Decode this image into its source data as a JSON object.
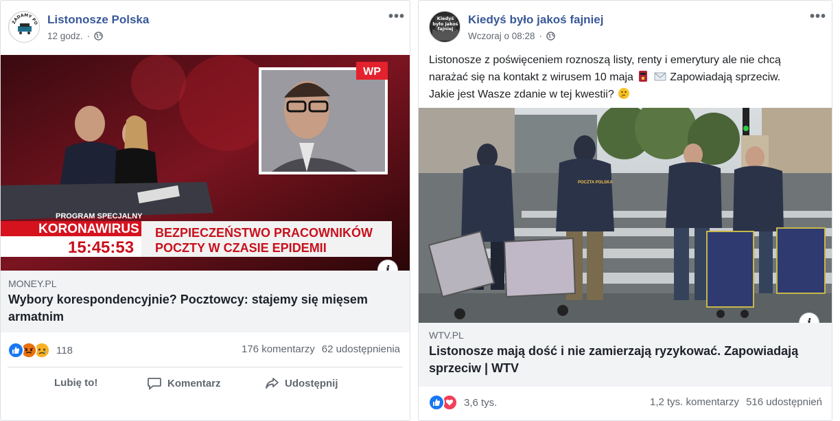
{
  "post1": {
    "page_name": "Listonosze Polska",
    "time": "12 godz.",
    "avatar_text": "ZADAMY PODWYŻEK",
    "media": {
      "tv_logo": "WP",
      "program_label": "PROGRAM SPECJALNY",
      "topic": "KORONAWIRUS",
      "clock": "15:45:53",
      "headline_line1": "BEZPIECZEŃSTWO PRACOWNIKÓW",
      "headline_line2": "POCZTY W CZASIE EPIDEMII"
    },
    "link": {
      "domain": "MONEY.PL",
      "title": "Wybory korespondencyjnie? Pocztowcy: stajemy się mięsem armatnim"
    },
    "reactions_count": "118",
    "comments": "176 komentarzy",
    "shares": "62 udostępnienia",
    "actions": {
      "like": "Lubię to!",
      "comment": "Komentarz",
      "share": "Udostępnij"
    }
  },
  "post2": {
    "page_name": "Kiedyś było jakoś fajniej",
    "time": "Wczoraj o 08:28",
    "avatar_text": "Kiedyś było jakoś fajniej",
    "text_line1": "Listonosze z poświęceniem roznoszą listy, renty i emerytury ale nie chcą",
    "text_line2a": "narażać się na kontakt z wirusem 10 maja",
    "text_line2b": "Zapowiadają sprzeciw.",
    "text_line3": "Jakie jest Wasze zdanie w tej kwestii?",
    "media": {
      "jacket_label": "POCZTA POLSKA"
    },
    "link": {
      "domain": "WTV.PL",
      "title": "Listonosze mają dość i nie zamierzają ryzykować. Zapowiadają sprzeciw | WTV"
    },
    "reactions_count": "3,6 tys.",
    "comments": "1,2 tys. komentarzy",
    "shares": "516 udostępnień"
  },
  "colors": {
    "link_blue": "#385898",
    "like_blue": "#1877f2",
    "love_red": "#f33e58",
    "angry_orange": "#e9710f",
    "sad_yellow": "#f7b125",
    "meta_gray": "#606770"
  }
}
